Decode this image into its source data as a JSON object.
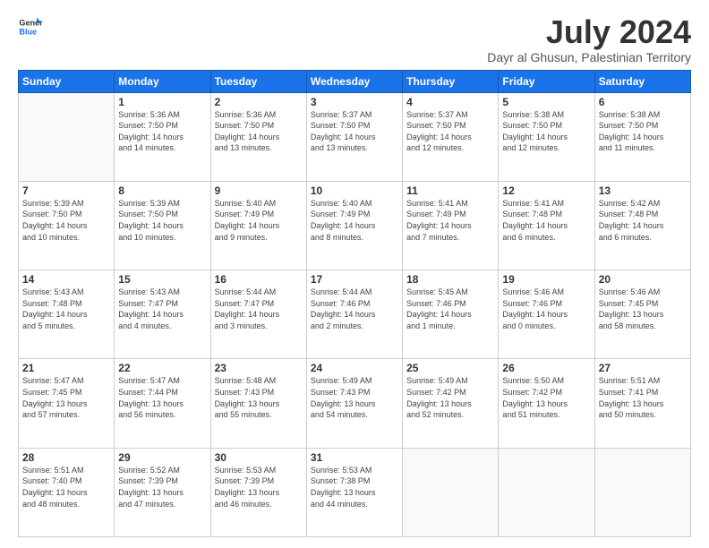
{
  "logo": {
    "line1": "General",
    "line2": "Blue"
  },
  "title": "July 2024",
  "subtitle": "Dayr al Ghusun, Palestinian Territory",
  "headers": [
    "Sunday",
    "Monday",
    "Tuesday",
    "Wednesday",
    "Thursday",
    "Friday",
    "Saturday"
  ],
  "weeks": [
    [
      {
        "day": "",
        "info": ""
      },
      {
        "day": "1",
        "info": "Sunrise: 5:36 AM\nSunset: 7:50 PM\nDaylight: 14 hours\nand 14 minutes."
      },
      {
        "day": "2",
        "info": "Sunrise: 5:36 AM\nSunset: 7:50 PM\nDaylight: 14 hours\nand 13 minutes."
      },
      {
        "day": "3",
        "info": "Sunrise: 5:37 AM\nSunset: 7:50 PM\nDaylight: 14 hours\nand 13 minutes."
      },
      {
        "day": "4",
        "info": "Sunrise: 5:37 AM\nSunset: 7:50 PM\nDaylight: 14 hours\nand 12 minutes."
      },
      {
        "day": "5",
        "info": "Sunrise: 5:38 AM\nSunset: 7:50 PM\nDaylight: 14 hours\nand 12 minutes."
      },
      {
        "day": "6",
        "info": "Sunrise: 5:38 AM\nSunset: 7:50 PM\nDaylight: 14 hours\nand 11 minutes."
      }
    ],
    [
      {
        "day": "7",
        "info": "Sunrise: 5:39 AM\nSunset: 7:50 PM\nDaylight: 14 hours\nand 10 minutes."
      },
      {
        "day": "8",
        "info": "Sunrise: 5:39 AM\nSunset: 7:50 PM\nDaylight: 14 hours\nand 10 minutes."
      },
      {
        "day": "9",
        "info": "Sunrise: 5:40 AM\nSunset: 7:49 PM\nDaylight: 14 hours\nand 9 minutes."
      },
      {
        "day": "10",
        "info": "Sunrise: 5:40 AM\nSunset: 7:49 PM\nDaylight: 14 hours\nand 8 minutes."
      },
      {
        "day": "11",
        "info": "Sunrise: 5:41 AM\nSunset: 7:49 PM\nDaylight: 14 hours\nand 7 minutes."
      },
      {
        "day": "12",
        "info": "Sunrise: 5:41 AM\nSunset: 7:48 PM\nDaylight: 14 hours\nand 6 minutes."
      },
      {
        "day": "13",
        "info": "Sunrise: 5:42 AM\nSunset: 7:48 PM\nDaylight: 14 hours\nand 6 minutes."
      }
    ],
    [
      {
        "day": "14",
        "info": "Sunrise: 5:43 AM\nSunset: 7:48 PM\nDaylight: 14 hours\nand 5 minutes."
      },
      {
        "day": "15",
        "info": "Sunrise: 5:43 AM\nSunset: 7:47 PM\nDaylight: 14 hours\nand 4 minutes."
      },
      {
        "day": "16",
        "info": "Sunrise: 5:44 AM\nSunset: 7:47 PM\nDaylight: 14 hours\nand 3 minutes."
      },
      {
        "day": "17",
        "info": "Sunrise: 5:44 AM\nSunset: 7:46 PM\nDaylight: 14 hours\nand 2 minutes."
      },
      {
        "day": "18",
        "info": "Sunrise: 5:45 AM\nSunset: 7:46 PM\nDaylight: 14 hours\nand 1 minute."
      },
      {
        "day": "19",
        "info": "Sunrise: 5:46 AM\nSunset: 7:46 PM\nDaylight: 14 hours\nand 0 minutes."
      },
      {
        "day": "20",
        "info": "Sunrise: 5:46 AM\nSunset: 7:45 PM\nDaylight: 13 hours\nand 58 minutes."
      }
    ],
    [
      {
        "day": "21",
        "info": "Sunrise: 5:47 AM\nSunset: 7:45 PM\nDaylight: 13 hours\nand 57 minutes."
      },
      {
        "day": "22",
        "info": "Sunrise: 5:47 AM\nSunset: 7:44 PM\nDaylight: 13 hours\nand 56 minutes."
      },
      {
        "day": "23",
        "info": "Sunrise: 5:48 AM\nSunset: 7:43 PM\nDaylight: 13 hours\nand 55 minutes."
      },
      {
        "day": "24",
        "info": "Sunrise: 5:49 AM\nSunset: 7:43 PM\nDaylight: 13 hours\nand 54 minutes."
      },
      {
        "day": "25",
        "info": "Sunrise: 5:49 AM\nSunset: 7:42 PM\nDaylight: 13 hours\nand 52 minutes."
      },
      {
        "day": "26",
        "info": "Sunrise: 5:50 AM\nSunset: 7:42 PM\nDaylight: 13 hours\nand 51 minutes."
      },
      {
        "day": "27",
        "info": "Sunrise: 5:51 AM\nSunset: 7:41 PM\nDaylight: 13 hours\nand 50 minutes."
      }
    ],
    [
      {
        "day": "28",
        "info": "Sunrise: 5:51 AM\nSunset: 7:40 PM\nDaylight: 13 hours\nand 48 minutes."
      },
      {
        "day": "29",
        "info": "Sunrise: 5:52 AM\nSunset: 7:39 PM\nDaylight: 13 hours\nand 47 minutes."
      },
      {
        "day": "30",
        "info": "Sunrise: 5:53 AM\nSunset: 7:39 PM\nDaylight: 13 hours\nand 46 minutes."
      },
      {
        "day": "31",
        "info": "Sunrise: 5:53 AM\nSunset: 7:38 PM\nDaylight: 13 hours\nand 44 minutes."
      },
      {
        "day": "",
        "info": ""
      },
      {
        "day": "",
        "info": ""
      },
      {
        "day": "",
        "info": ""
      }
    ]
  ]
}
